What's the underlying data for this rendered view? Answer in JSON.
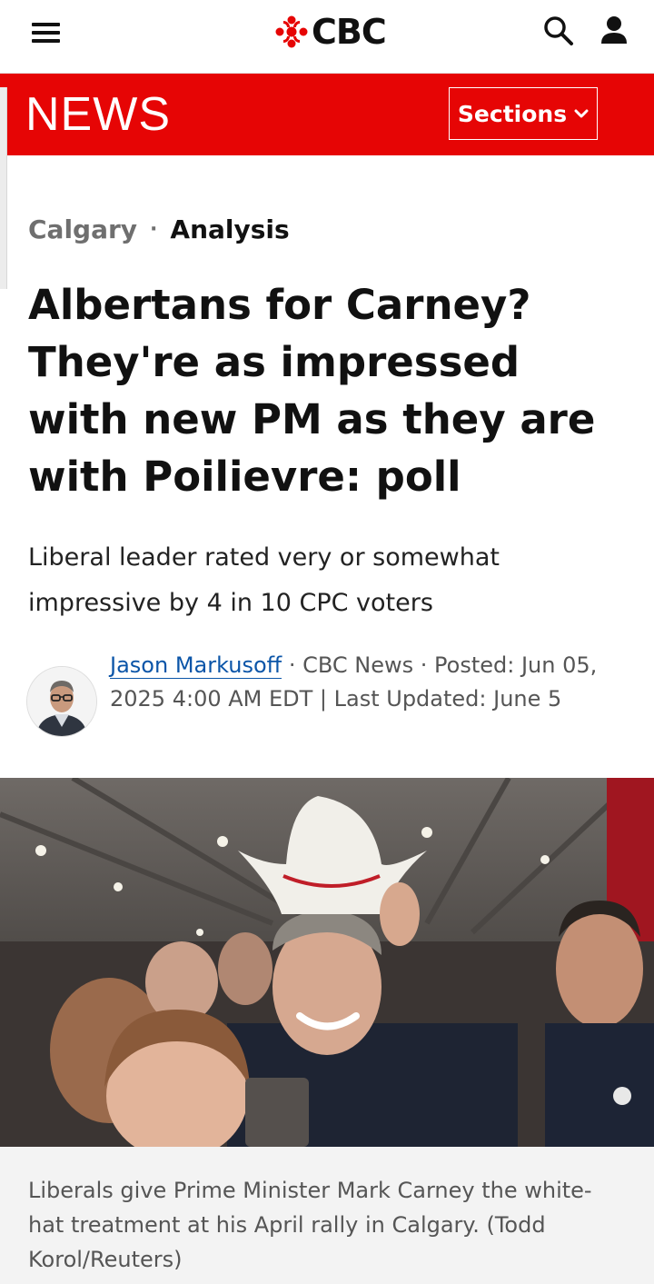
{
  "header": {
    "brand": "CBC",
    "menu_icon": "hamburger-menu-icon",
    "search_icon": "search-icon",
    "account_icon": "user-icon"
  },
  "newsbar": {
    "title": "NEWS",
    "sections_label": "Sections",
    "background": "#e60505"
  },
  "article": {
    "breadcrumb": {
      "section": "Calgary",
      "separator": "·",
      "type": "Analysis"
    },
    "headline": "Albertans for Carney? They're as impressed with new PM as they are with Poilievre: poll",
    "deck": "Liberal leader rated very or somewhat impressive by 4 in 10 CPC voters",
    "byline": {
      "author": "Jason Markusoff",
      "outlet_suffix": " · CBC News ·",
      "dates": "Posted: Jun 05, 2025 4:00 AM EDT | Last Updated: June 5"
    },
    "photo": {
      "caption": "Liberals give Prime Minister Mark Carney the white-hat treatment at his April rally in Calgary. (Todd Korol/Reuters)"
    }
  },
  "colors": {
    "accent_red": "#e60505",
    "link_blue": "#0b55a8",
    "muted_text": "#555555"
  }
}
